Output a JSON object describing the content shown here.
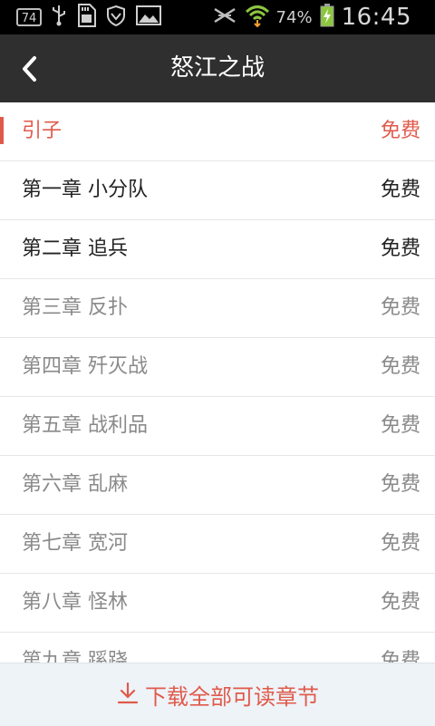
{
  "status_bar": {
    "notification_badge": "74",
    "battery_percent": "74%",
    "time": "16:45",
    "icons": [
      "notification-count-icon",
      "usb-icon",
      "sd-card-icon",
      "shield-icon",
      "image-icon",
      "signal-muted-icon",
      "wifi-icon",
      "battery-charging-icon"
    ]
  },
  "header": {
    "title": "怒江之战",
    "back_icon": "chevron-left-icon"
  },
  "chapters": [
    {
      "title": "引子",
      "price": "免费",
      "state": "current"
    },
    {
      "title": "第一章 小分队",
      "price": "免费",
      "state": "read"
    },
    {
      "title": "第二章 追兵",
      "price": "免费",
      "state": "read"
    },
    {
      "title": "第三章 反扑",
      "price": "免费",
      "state": "unread"
    },
    {
      "title": "第四章 歼灭战",
      "price": "免费",
      "state": "unread"
    },
    {
      "title": "第五章 战利品",
      "price": "免费",
      "state": "unread"
    },
    {
      "title": "第六章 乱麻",
      "price": "免费",
      "state": "unread"
    },
    {
      "title": "第七章 宽河",
      "price": "免费",
      "state": "unread"
    },
    {
      "title": "第八章 怪林",
      "price": "免费",
      "state": "unread"
    },
    {
      "title": "第九章 蹊跷",
      "price": "免费",
      "state": "unread"
    }
  ],
  "download": {
    "label": "下载全部可读章节",
    "icon": "download-icon"
  },
  "colors": {
    "accent": "#e05a4b",
    "header_bg": "#2f2f2f",
    "status_bg": "#000000",
    "read_text": "#222222",
    "unread_text": "#8a8a8a",
    "download_bg": "#eef3f8"
  }
}
